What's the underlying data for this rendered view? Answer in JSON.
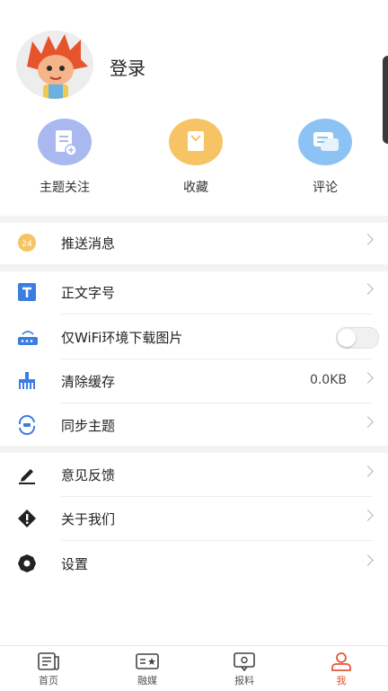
{
  "profile": {
    "login_label": "登录"
  },
  "quick_actions": [
    {
      "label": "主题关注",
      "icon": "doc-add-icon",
      "color": "#a9b8ef"
    },
    {
      "label": "收藏",
      "icon": "bookmark-icon",
      "color": "#f6c365"
    },
    {
      "label": "评论",
      "icon": "comment-icon",
      "color": "#8cc3f4"
    }
  ],
  "menu": {
    "push": {
      "label": "推送消息",
      "icon": "clock-24-icon"
    },
    "font": {
      "label": "正文字号",
      "icon": "text-t-icon"
    },
    "wifi": {
      "label": "仅WiFi环境下载图片",
      "icon": "router-icon",
      "enabled": false
    },
    "cache": {
      "label": "清除缓存",
      "value": "0.0KB",
      "icon": "broom-icon"
    },
    "sync": {
      "label": "同步主题",
      "icon": "sync-icon"
    },
    "feedback": {
      "label": "意见反馈",
      "icon": "pencil-icon"
    },
    "about": {
      "label": "关于我们",
      "icon": "warning-icon"
    },
    "settings": {
      "label": "设置",
      "icon": "gear-icon"
    }
  },
  "tabs": [
    {
      "label": "首页",
      "icon": "newspaper-icon"
    },
    {
      "label": "融媒",
      "icon": "media-icon"
    },
    {
      "label": "报料",
      "icon": "report-icon"
    },
    {
      "label": "我",
      "icon": "person-icon",
      "active": true
    }
  ],
  "colors": {
    "accent": "#e8543a",
    "icon_blue": "#3c7de2"
  }
}
